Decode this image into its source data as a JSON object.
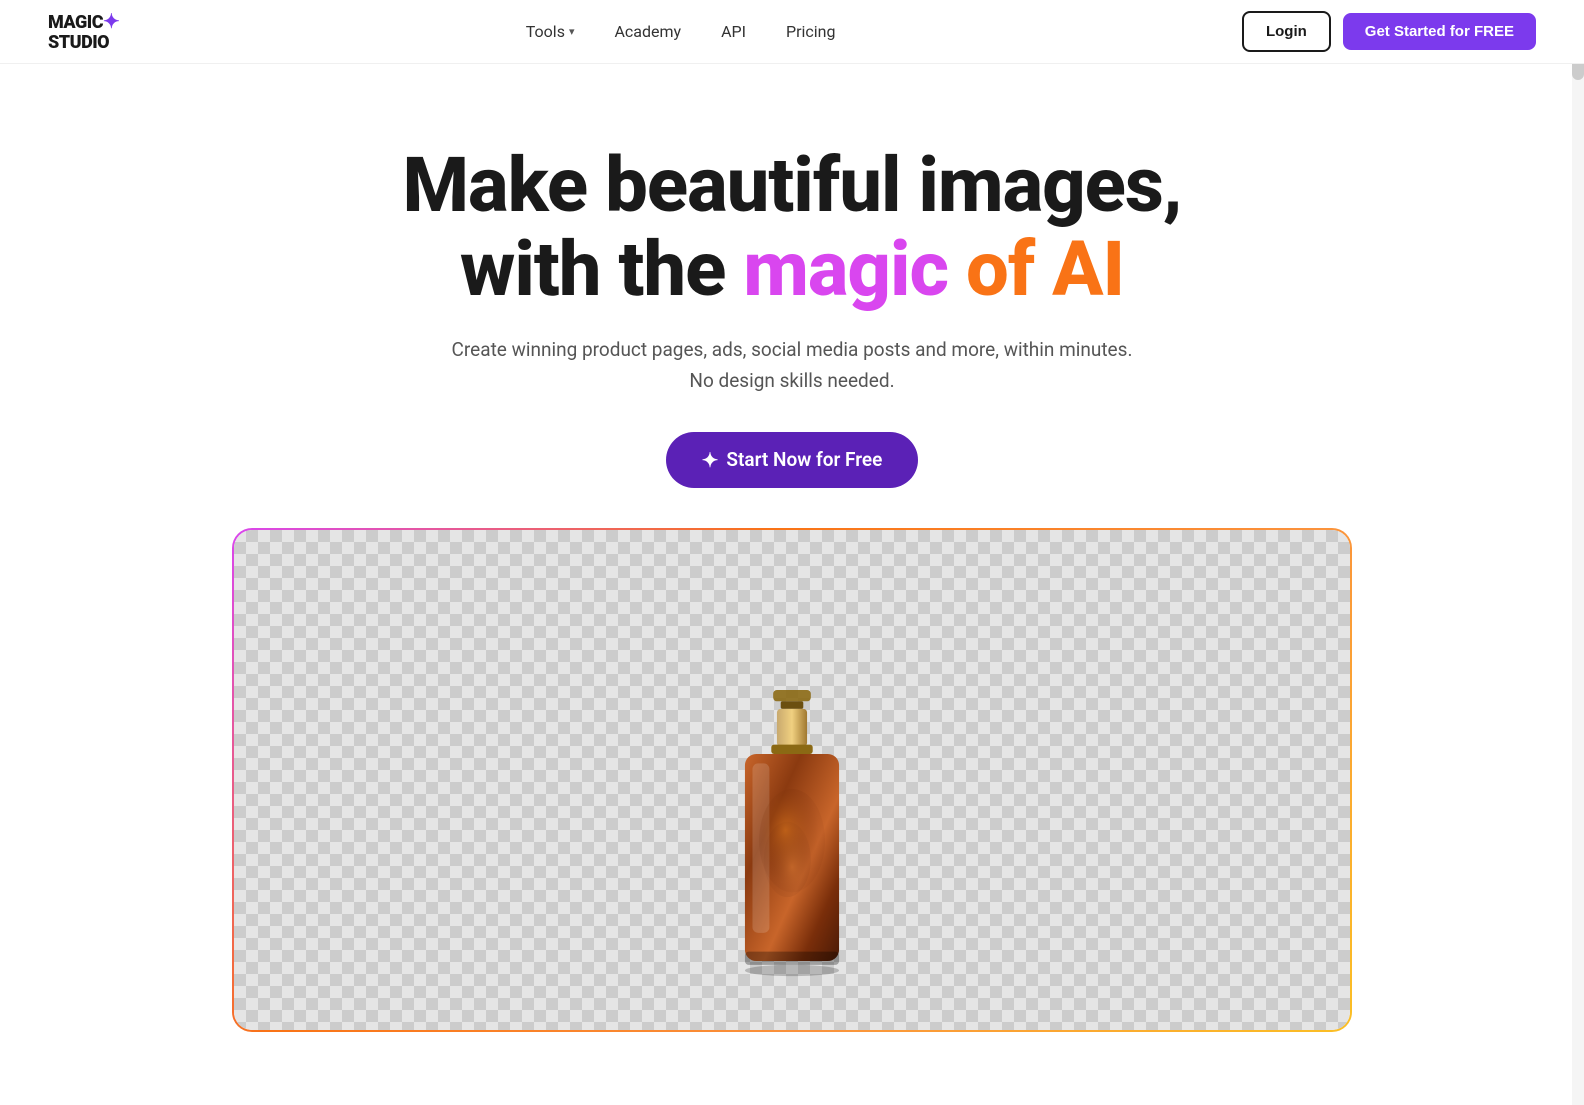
{
  "nav": {
    "logo_line1": "MAGIC",
    "logo_line2": "STUDIO",
    "links": [
      {
        "id": "tools",
        "label": "Tools",
        "has_dropdown": true
      },
      {
        "id": "academy",
        "label": "Academy",
        "has_dropdown": false
      },
      {
        "id": "api",
        "label": "API",
        "has_dropdown": false
      },
      {
        "id": "pricing",
        "label": "Pricing",
        "has_dropdown": false
      }
    ],
    "login_label": "Login",
    "cta_label": "Get Started for FREE"
  },
  "hero": {
    "title_line1": "Make beautiful images,",
    "title_line2_plain": "with the ",
    "title_magic": "magic",
    "title_of": " of ",
    "title_ai": "AI",
    "subtitle_line1": "Create winning product pages, ads, social media posts and more, within minutes.",
    "subtitle_line2": "No design skills needed.",
    "cta_label": "Start Now for Free"
  },
  "colors": {
    "purple": "#7c3aed",
    "purple_dark": "#5b21b6",
    "magic_pink": "#d946ef",
    "ai_orange": "#f97316",
    "gradient_start": "#d946ef",
    "gradient_end": "#f97316"
  }
}
